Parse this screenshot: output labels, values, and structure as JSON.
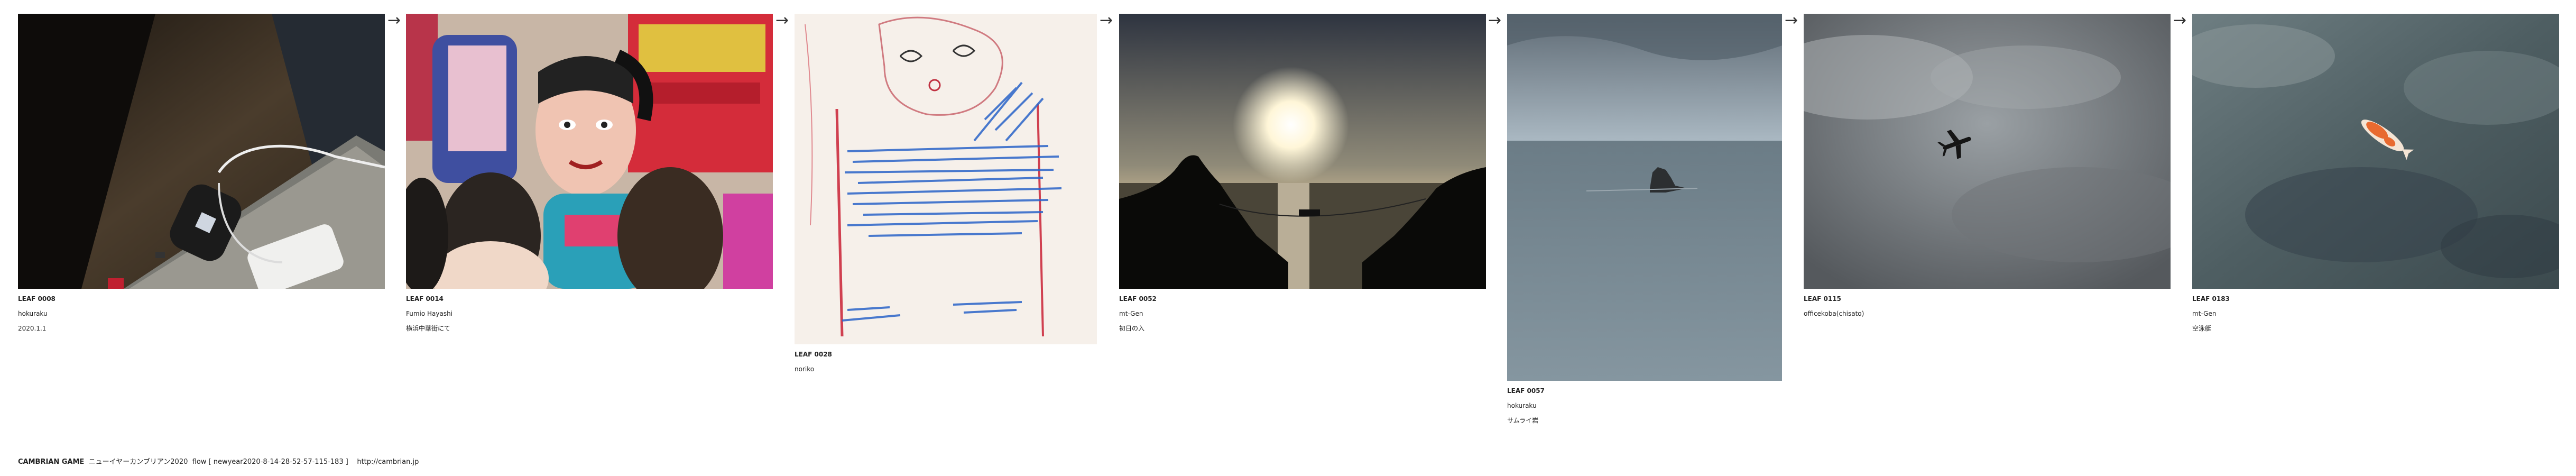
{
  "leaves": [
    {
      "code": "LEAF 0008",
      "author": "hokuraku",
      "note": "2020.1.1"
    },
    {
      "code": "LEAF 0014",
      "author": "Fumio Hayashi",
      "note": "横浜中華街にて"
    },
    {
      "code": "LEAF 0028",
      "author": "noriko",
      "note": ""
    },
    {
      "code": "LEAF 0052",
      "author": "mt-Gen",
      "note": "初日の入"
    },
    {
      "code": "LEAF 0057",
      "author": "hokuraku",
      "note": "サムライ岩"
    },
    {
      "code": "LEAF 0115",
      "author": "officekoba(chisato)",
      "note": ""
    },
    {
      "code": "LEAF 0183",
      "author": "mt-Gen",
      "note": "空泳艇"
    }
  ],
  "arrow": "→",
  "footer": {
    "brand": "CAMBRIAN GAME",
    "text": "ニューイヤーカンブリアン2020  flow [ newyear2020-8-14-28-52-57-115-183 ]    http://cambrian.jp"
  }
}
